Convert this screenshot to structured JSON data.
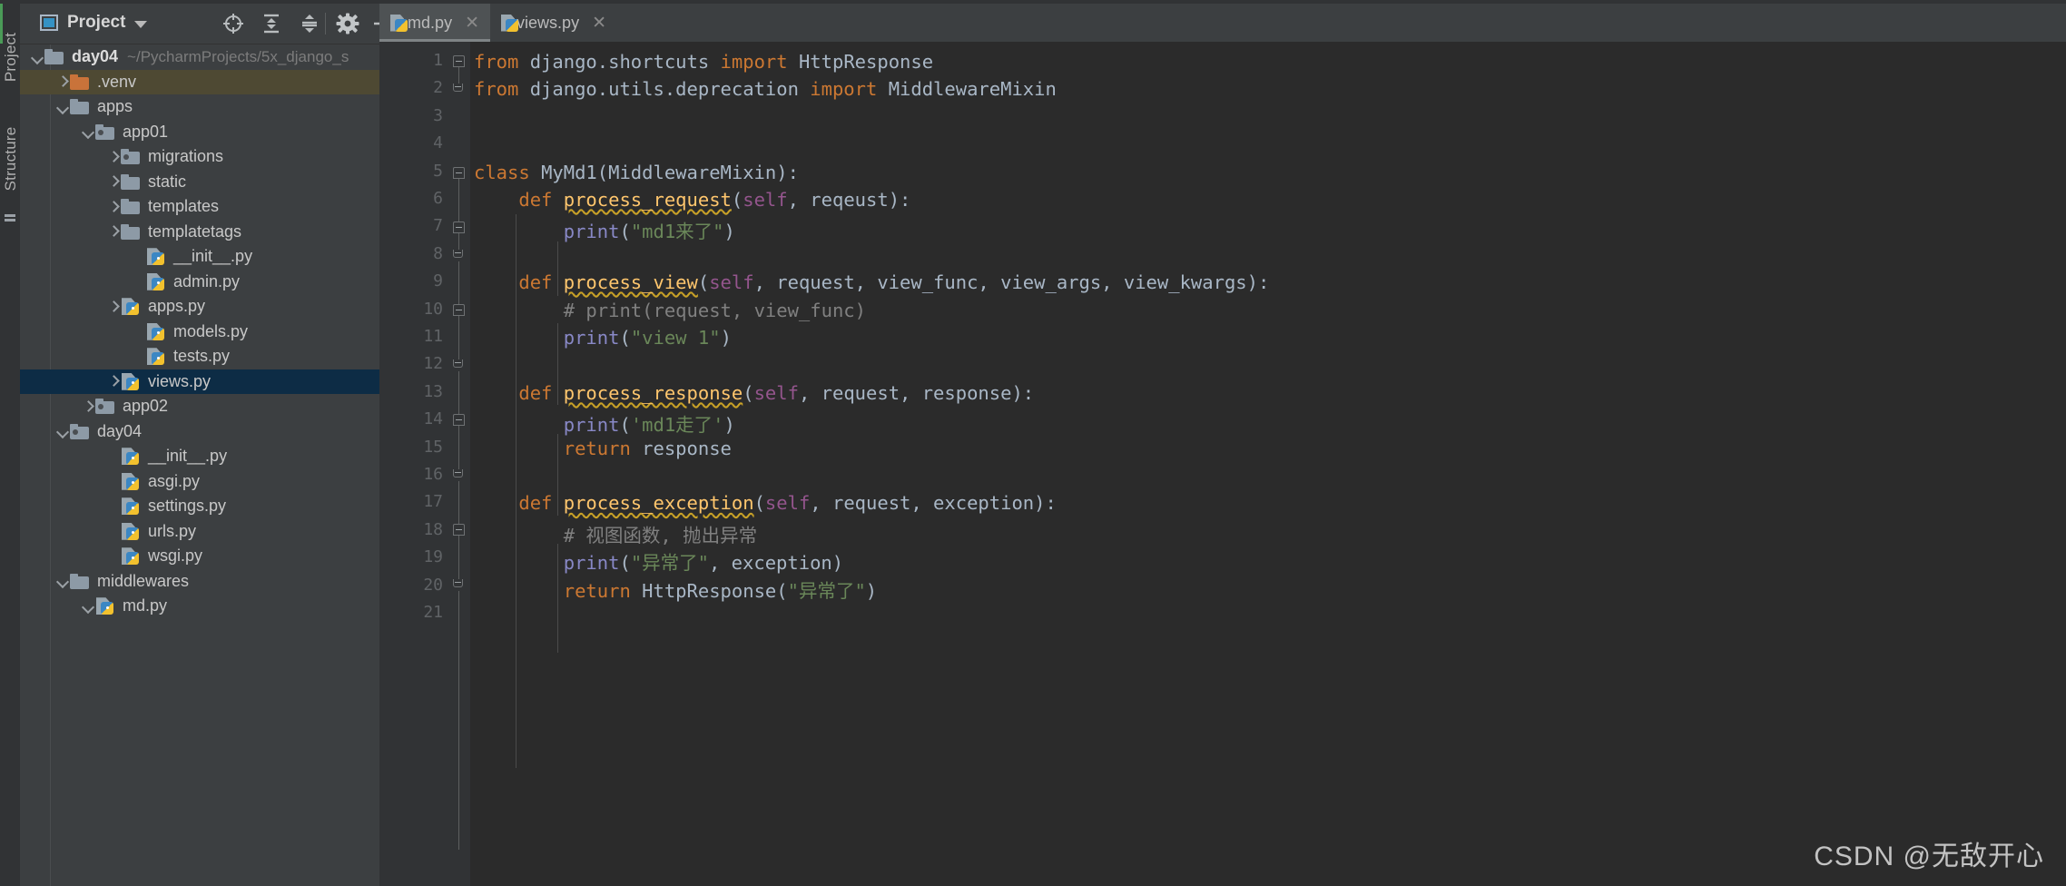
{
  "toolwindows": {
    "project_label": "Project",
    "structure_label": "Structure"
  },
  "project_panel": {
    "title": "Project",
    "icons": [
      {
        "name": "locate-icon",
        "glyph": "target"
      },
      {
        "name": "expand-all-icon",
        "glyph": "expand"
      },
      {
        "name": "collapse-all-icon",
        "glyph": "collapse"
      },
      {
        "name": "settings-gear-icon",
        "glyph": "gear"
      },
      {
        "name": "hide-window-icon",
        "glyph": "minus"
      }
    ],
    "tree": [
      {
        "label": "day04",
        "path": "~/PycharmProjects/5x_django_s",
        "type": "folder",
        "indent": 0,
        "arrow": "down",
        "bold": true
      },
      {
        "label": ".venv",
        "path": "",
        "type": "folder-orange",
        "indent": 1,
        "arrow": "right",
        "state": "venv"
      },
      {
        "label": "apps",
        "path": "",
        "type": "folder",
        "indent": 1,
        "arrow": "down"
      },
      {
        "label": "app01",
        "path": "",
        "type": "folder-package",
        "indent": 2,
        "arrow": "down"
      },
      {
        "label": "migrations",
        "path": "",
        "type": "folder-package",
        "indent": 3,
        "arrow": "right"
      },
      {
        "label": "static",
        "path": "",
        "type": "folder",
        "indent": 3,
        "arrow": "right"
      },
      {
        "label": "templates",
        "path": "",
        "type": "folder",
        "indent": 3,
        "arrow": "right"
      },
      {
        "label": "templatetags",
        "path": "",
        "type": "folder",
        "indent": 3,
        "arrow": "right"
      },
      {
        "label": "__init__.py",
        "path": "",
        "type": "python",
        "indent": 4,
        "arrow": "none"
      },
      {
        "label": "admin.py",
        "path": "",
        "type": "python",
        "indent": 4,
        "arrow": "none"
      },
      {
        "label": "apps.py",
        "path": "",
        "type": "python",
        "indent": 3,
        "arrow": "right"
      },
      {
        "label": "models.py",
        "path": "",
        "type": "python",
        "indent": 4,
        "arrow": "none"
      },
      {
        "label": "tests.py",
        "path": "",
        "type": "python",
        "indent": 4,
        "arrow": "none"
      },
      {
        "label": "views.py",
        "path": "",
        "type": "python",
        "indent": 3,
        "arrow": "right",
        "state": "selected"
      },
      {
        "label": "app02",
        "path": "",
        "type": "folder-package",
        "indent": 2,
        "arrow": "right"
      },
      {
        "label": "day04",
        "path": "",
        "type": "folder-package",
        "indent": 1,
        "arrow": "down"
      },
      {
        "label": "__init__.py",
        "path": "",
        "type": "python",
        "indent": 3,
        "arrow": "none"
      },
      {
        "label": "asgi.py",
        "path": "",
        "type": "python",
        "indent": 3,
        "arrow": "none"
      },
      {
        "label": "settings.py",
        "path": "",
        "type": "python",
        "indent": 3,
        "arrow": "none"
      },
      {
        "label": "urls.py",
        "path": "",
        "type": "python",
        "indent": 3,
        "arrow": "none"
      },
      {
        "label": "wsgi.py",
        "path": "",
        "type": "python",
        "indent": 3,
        "arrow": "none"
      },
      {
        "label": "middlewares",
        "path": "",
        "type": "folder",
        "indent": 1,
        "arrow": "down"
      },
      {
        "label": "md.py",
        "path": "",
        "type": "python",
        "indent": 2,
        "arrow": "down"
      }
    ]
  },
  "editor": {
    "tabs": [
      {
        "label": "md.py",
        "active": true,
        "closable": true
      },
      {
        "label": "views.py",
        "active": false,
        "closable": true
      }
    ],
    "line_numbers": [
      "1",
      "2",
      "3",
      "4",
      "5",
      "6",
      "7",
      "8",
      "9",
      "10",
      "11",
      "12",
      "13",
      "14",
      "15",
      "16",
      "17",
      "18",
      "19",
      "20",
      "21"
    ],
    "code": [
      {
        "n": 1,
        "tokens": [
          {
            "t": "from ",
            "c": "kw"
          },
          {
            "t": "django.shortcuts ",
            "c": "id"
          },
          {
            "t": "import ",
            "c": "kw"
          },
          {
            "t": "HttpResponse",
            "c": "id"
          }
        ]
      },
      {
        "n": 2,
        "tokens": [
          {
            "t": "from ",
            "c": "kw"
          },
          {
            "t": "django.utils.deprecation ",
            "c": "id"
          },
          {
            "t": "import ",
            "c": "kw"
          },
          {
            "t": "MiddlewareMixin",
            "c": "id"
          }
        ]
      },
      {
        "n": 3,
        "tokens": []
      },
      {
        "n": 4,
        "tokens": []
      },
      {
        "n": 5,
        "tokens": [
          {
            "t": "class ",
            "c": "kw"
          },
          {
            "t": "MyMd1(MiddlewareMixin):",
            "c": "id"
          }
        ]
      },
      {
        "n": 6,
        "tokens": [
          {
            "t": "    ",
            "c": "id"
          },
          {
            "t": "def ",
            "c": "kw"
          },
          {
            "t": "process_request",
            "c": "fn err"
          },
          {
            "t": "(",
            "c": "id"
          },
          {
            "t": "self",
            "c": "slf"
          },
          {
            "t": ", reqeust):",
            "c": "id"
          }
        ]
      },
      {
        "n": 7,
        "tokens": [
          {
            "t": "        ",
            "c": "id"
          },
          {
            "t": "print",
            "c": "bi"
          },
          {
            "t": "(",
            "c": "id"
          },
          {
            "t": "\"md1来了\"",
            "c": "str"
          },
          {
            "t": ")",
            "c": "id"
          }
        ]
      },
      {
        "n": 8,
        "tokens": []
      },
      {
        "n": 9,
        "tokens": [
          {
            "t": "    ",
            "c": "id"
          },
          {
            "t": "def ",
            "c": "kw"
          },
          {
            "t": "process_view",
            "c": "fn err"
          },
          {
            "t": "(",
            "c": "id"
          },
          {
            "t": "self",
            "c": "slf"
          },
          {
            "t": ", request, view_func, view_args, view_kwargs):",
            "c": "id"
          }
        ]
      },
      {
        "n": 10,
        "tokens": [
          {
            "t": "        ",
            "c": "id"
          },
          {
            "t": "# print(request, view_func)",
            "c": "cm"
          }
        ]
      },
      {
        "n": 11,
        "tokens": [
          {
            "t": "        ",
            "c": "id"
          },
          {
            "t": "print",
            "c": "bi"
          },
          {
            "t": "(",
            "c": "id"
          },
          {
            "t": "\"view 1\"",
            "c": "str"
          },
          {
            "t": ")",
            "c": "id"
          }
        ]
      },
      {
        "n": 12,
        "tokens": []
      },
      {
        "n": 13,
        "tokens": [
          {
            "t": "    ",
            "c": "id"
          },
          {
            "t": "def ",
            "c": "kw"
          },
          {
            "t": "process_response",
            "c": "fn err"
          },
          {
            "t": "(",
            "c": "id"
          },
          {
            "t": "self",
            "c": "slf"
          },
          {
            "t": ", request, response):",
            "c": "id"
          }
        ]
      },
      {
        "n": 14,
        "tokens": [
          {
            "t": "        ",
            "c": "id"
          },
          {
            "t": "print",
            "c": "bi"
          },
          {
            "t": "(",
            "c": "id"
          },
          {
            "t": "'md1走了'",
            "c": "str"
          },
          {
            "t": ")",
            "c": "id"
          }
        ]
      },
      {
        "n": 15,
        "tokens": [
          {
            "t": "        ",
            "c": "id"
          },
          {
            "t": "return ",
            "c": "kw"
          },
          {
            "t": "response",
            "c": "id"
          }
        ]
      },
      {
        "n": 16,
        "tokens": []
      },
      {
        "n": 17,
        "tokens": [
          {
            "t": "    ",
            "c": "id"
          },
          {
            "t": "def ",
            "c": "kw"
          },
          {
            "t": "process_exception",
            "c": "fn err"
          },
          {
            "t": "(",
            "c": "id"
          },
          {
            "t": "self",
            "c": "slf"
          },
          {
            "t": ", request, exception):",
            "c": "id"
          }
        ]
      },
      {
        "n": 18,
        "tokens": [
          {
            "t": "        ",
            "c": "id"
          },
          {
            "t": "# 视图函数, 抛出异常",
            "c": "cm"
          }
        ]
      },
      {
        "n": 19,
        "tokens": [
          {
            "t": "        ",
            "c": "id"
          },
          {
            "t": "print",
            "c": "bi"
          },
          {
            "t": "(",
            "c": "id"
          },
          {
            "t": "\"异常了\"",
            "c": "str"
          },
          {
            "t": ", exception)",
            "c": "id"
          }
        ]
      },
      {
        "n": 20,
        "tokens": [
          {
            "t": "        ",
            "c": "id"
          },
          {
            "t": "return ",
            "c": "kw"
          },
          {
            "t": "HttpResponse(",
            "c": "id"
          },
          {
            "t": "\"异常了\"",
            "c": "str"
          },
          {
            "t": ")",
            "c": "id"
          }
        ]
      },
      {
        "n": 21,
        "tokens": []
      }
    ]
  },
  "watermark": {
    "text": "CSDN @无敌开心"
  },
  "colors": {
    "editor_bg": "#2b2b2b",
    "panel_bg": "#3c3f41",
    "gutter_bg": "#313335",
    "selection": "#0d2c45",
    "venv_highlight": "#4e4933",
    "keyword": "#cc7832",
    "function": "#ffc66d",
    "string": "#6a8759",
    "comment": "#808080",
    "self": "#94558d",
    "builtin": "#8888c6",
    "identifier": "#a9b7c6"
  }
}
